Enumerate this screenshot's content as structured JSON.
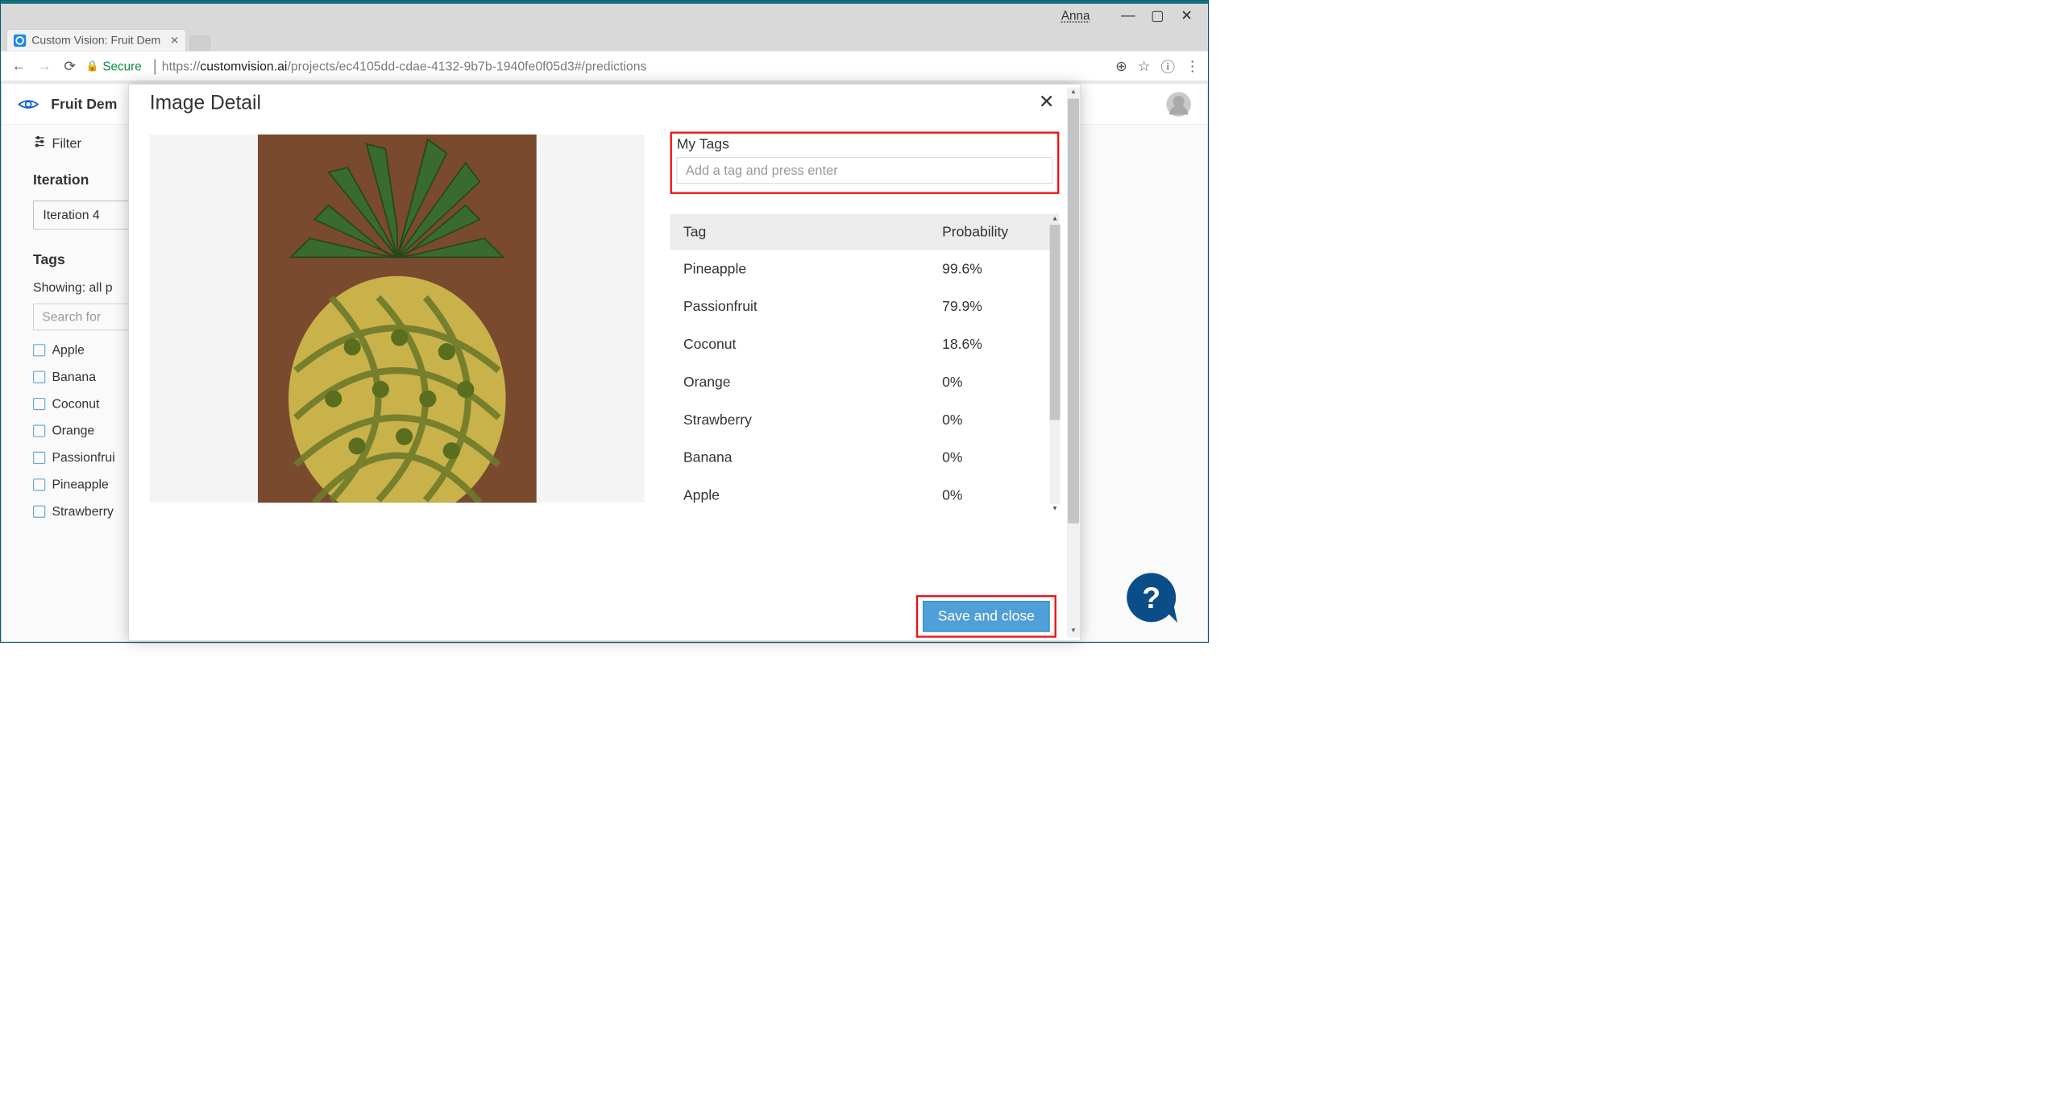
{
  "osbar": {
    "username": "Anna",
    "minimize": "—",
    "maximize": "▢",
    "close": "✕"
  },
  "browser_tab": {
    "title": "Custom Vision: Fruit Dem",
    "close": "✕"
  },
  "addr": {
    "secure_label": "Secure",
    "url_scheme": "https://",
    "url_host": "customvision.ai",
    "url_path": "/projects/ec4105dd-cdae-4132-9b7b-1940fe0f05d3#/predictions"
  },
  "app": {
    "project_name": "Fruit Dem",
    "breadcrumb_gt": ">",
    "help_q": "?"
  },
  "sidebar": {
    "filter_label": "Filter",
    "iteration_label": "Iteration",
    "iteration_value": "Iteration 4",
    "tags_label": "Tags",
    "showing_text": "Showing: all p",
    "search_placeholder": "Search for",
    "tags": [
      "Apple",
      "Banana",
      "Coconut",
      "Orange",
      "Passionfrui",
      "Pineapple",
      "Strawberry"
    ]
  },
  "modal": {
    "title": "Image Detail",
    "close": "✕",
    "mytags_label": "My Tags",
    "tag_input_placeholder": "Add a tag and press enter",
    "table": {
      "col_tag": "Tag",
      "col_prob": "Probability",
      "rows": [
        {
          "tag": "Pineapple",
          "prob": "99.6%"
        },
        {
          "tag": "Passionfruit",
          "prob": "79.9%"
        },
        {
          "tag": "Coconut",
          "prob": "18.6%"
        },
        {
          "tag": "Orange",
          "prob": "0%"
        },
        {
          "tag": "Strawberry",
          "prob": "0%"
        },
        {
          "tag": "Banana",
          "prob": "0%"
        },
        {
          "tag": "Apple",
          "prob": "0%"
        }
      ]
    },
    "save_label": "Save and close"
  },
  "help_button": "?"
}
